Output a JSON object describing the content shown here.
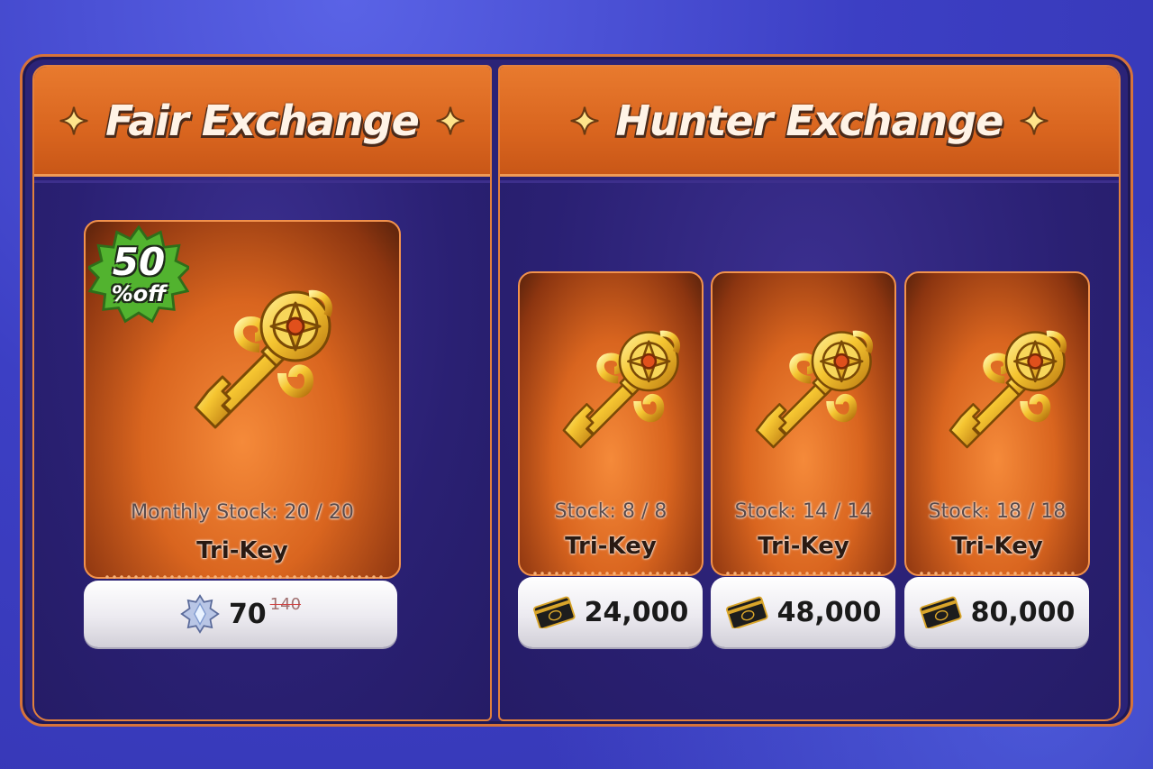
{
  "fair_exchange": {
    "title": "Fair Exchange",
    "discount": {
      "value": "50",
      "suffix": "%off"
    },
    "item": {
      "stock_label": "Monthly Stock:",
      "stock": "20 / 20",
      "name": "Tri-Key",
      "price": "70",
      "original_price": "140",
      "currency_icon": "crystal-currency-icon"
    }
  },
  "hunter_exchange": {
    "title": "Hunter Exchange",
    "items": [
      {
        "stock_label": "Stock:",
        "stock": "8 / 8",
        "name": "Tri-Key",
        "price": "24,000",
        "currency_icon": "hunter-card-icon"
      },
      {
        "stock_label": "Stock:",
        "stock": "14 / 14",
        "name": "Tri-Key",
        "price": "48,000",
        "currency_icon": "hunter-card-icon"
      },
      {
        "stock_label": "Stock:",
        "stock": "18 / 18",
        "name": "Tri-Key",
        "price": "80,000",
        "currency_icon": "hunter-card-icon"
      }
    ]
  },
  "colors": {
    "accent": "#e2813d",
    "panel": "#2a2073",
    "background": "#3c3fc4",
    "discount": "#4fae2e"
  }
}
